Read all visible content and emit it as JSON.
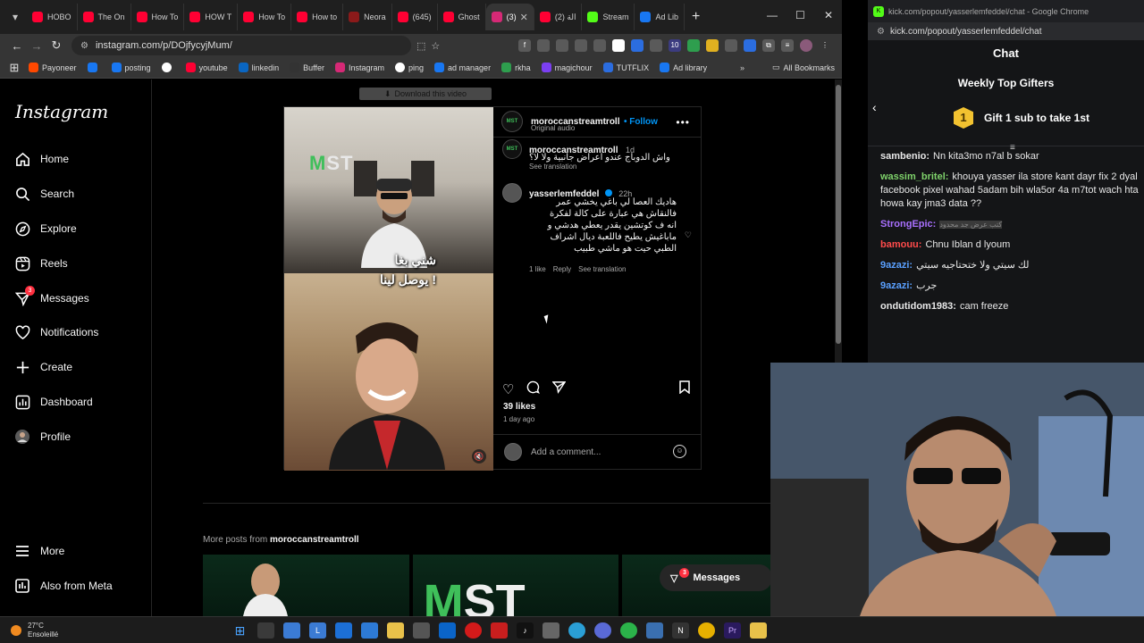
{
  "browser": {
    "tabs": [
      {
        "label": "HOBO",
        "color": "#ff0033"
      },
      {
        "label": "The On",
        "color": "#ff0033"
      },
      {
        "label": "How To",
        "color": "#ff0033"
      },
      {
        "label": "HOW T",
        "color": "#ff0033"
      },
      {
        "label": "How To",
        "color": "#ff0033"
      },
      {
        "label": "How to",
        "color": "#ff0033"
      },
      {
        "label": "Neora",
        "color": "#8b1a1a"
      },
      {
        "label": "(645)",
        "color": "#ff0033"
      },
      {
        "label": "Ghost",
        "color": "#ff0033"
      },
      {
        "label": "(3)",
        "color": "#d62976",
        "active": true
      },
      {
        "label": "(2) الة",
        "color": "#ff0033"
      },
      {
        "label": "Stream",
        "color": "#53fc18"
      },
      {
        "label": "Ad Lib",
        "color": "#1877f2"
      }
    ],
    "url": "instagram.com/p/DOjfycyjMum/",
    "bookmarks": [
      {
        "label": "Payoneer",
        "color": "#ff4800"
      },
      {
        "label": "",
        "color": "#1877f2"
      },
      {
        "label": "posting",
        "color": "#1877f2"
      },
      {
        "label": "",
        "color": "#ffffff"
      },
      {
        "label": "youtube",
        "color": "#ff0033"
      },
      {
        "label": "linkedin",
        "color": "#0a66c2"
      },
      {
        "label": "Buffer",
        "color": "#333333"
      },
      {
        "label": "Instagram",
        "color": "#d62976"
      },
      {
        "label": "ping",
        "color": "#ffffff"
      },
      {
        "label": "ad manager",
        "color": "#1877f2"
      },
      {
        "label": "rkha",
        "color": "#2e9e4e"
      },
      {
        "label": "magichour",
        "color": "#7b3ff2"
      },
      {
        "label": "TUTFLIX",
        "color": "#2b6de0"
      },
      {
        "label": "Ad library",
        "color": "#1877f2"
      }
    ],
    "all_bookmarks": "All Bookmarks"
  },
  "instagram": {
    "logo": "Instagram",
    "nav": [
      {
        "label": "Home",
        "icon": "home-icon"
      },
      {
        "label": "Search",
        "icon": "search-icon"
      },
      {
        "label": "Explore",
        "icon": "compass-icon"
      },
      {
        "label": "Reels",
        "icon": "reels-icon"
      },
      {
        "label": "Messages",
        "icon": "messages-icon",
        "badge": "3"
      },
      {
        "label": "Notifications",
        "icon": "heart-icon"
      },
      {
        "label": "Create",
        "icon": "plus-icon"
      },
      {
        "label": "Dashboard",
        "icon": "dashboard-icon"
      },
      {
        "label": "Profile",
        "icon": "profile-icon"
      }
    ],
    "more": "More",
    "also_from_meta": "Also from Meta",
    "download_bar": "Download this video",
    "post": {
      "author": "moroccanstreamtroll",
      "follow": "• Follow",
      "audio": "Original audio",
      "video_caption_line1": "شني بغا",
      "video_caption_line2": "يوصل لينا !",
      "video_logo": "MST",
      "caption_author": "moroccanstreamtroll",
      "caption_age": "1d",
      "caption_text": "واش الدوباج عندو اعراض جانبية ولا لا؟",
      "see_translation": "See translation",
      "comment": {
        "author": "yasserlemfeddel",
        "age": "22h",
        "text_lines": [
          "هاديك العصا لي باغي يخشي عمر",
          "فالنقاش هي عبارة على كالة لفكرة",
          "انه ف كوتشين يقدر يعطي هدشي و",
          "ماباغيش يطيح فاللعبة ديال اشراف",
          "الطبي حيت هو ماشي طبيب"
        ],
        "likes": "1 like",
        "reply": "Reply",
        "see_translation": "See translation"
      },
      "likes": "39 likes",
      "ago": "1 day ago",
      "add_comment": "Add a comment..."
    },
    "more_posts_prefix": "More posts from ",
    "more_posts_user": "moroccanstreamtroll",
    "messages_float": "Messages",
    "messages_badge": "3"
  },
  "kick": {
    "window_title": "kick.com/popout/yasserlemfeddel/chat - Google Chrome",
    "url": "kick.com/popout/yasserlemfeddel/chat",
    "header": "Chat",
    "gifters_title": "Weekly Top Gifters",
    "gift_rank": "1",
    "gift_text": "Gift 1 sub to take 1st",
    "messages": [
      {
        "user": "sambenio:",
        "text": "Nn kita3mo n7al b sokar",
        "color": "#e8e8e8"
      },
      {
        "user": "wassim_britel:",
        "text": "khouya yasser ila store kant dayr fix 2 dyal facebook pixel wahad 5adam bih wla5or 4a m7tot wach hta howa kay jma3 data ??",
        "color": "#7fd36b"
      },
      {
        "user": "StrongEpic:",
        "text": "كتب عرض جد محدود",
        "color": "#a970ff"
      },
      {
        "user": "bamouu:",
        "text": "Chnu Iblan d lyoum",
        "color": "#ff4b4b"
      },
      {
        "user": "9azazi:",
        "text": "لك سيتي ولا ختحتاجيه سيتي",
        "color": "#5aa0ff"
      },
      {
        "user": "9azazi:",
        "text": "جرب",
        "color": "#5aa0ff"
      },
      {
        "user": "ondutidom1983:",
        "text": "cam freeze",
        "color": "#e8e8e8"
      }
    ]
  },
  "taskbar": {
    "temp": "27°C",
    "condition": "Ensoleillé"
  }
}
